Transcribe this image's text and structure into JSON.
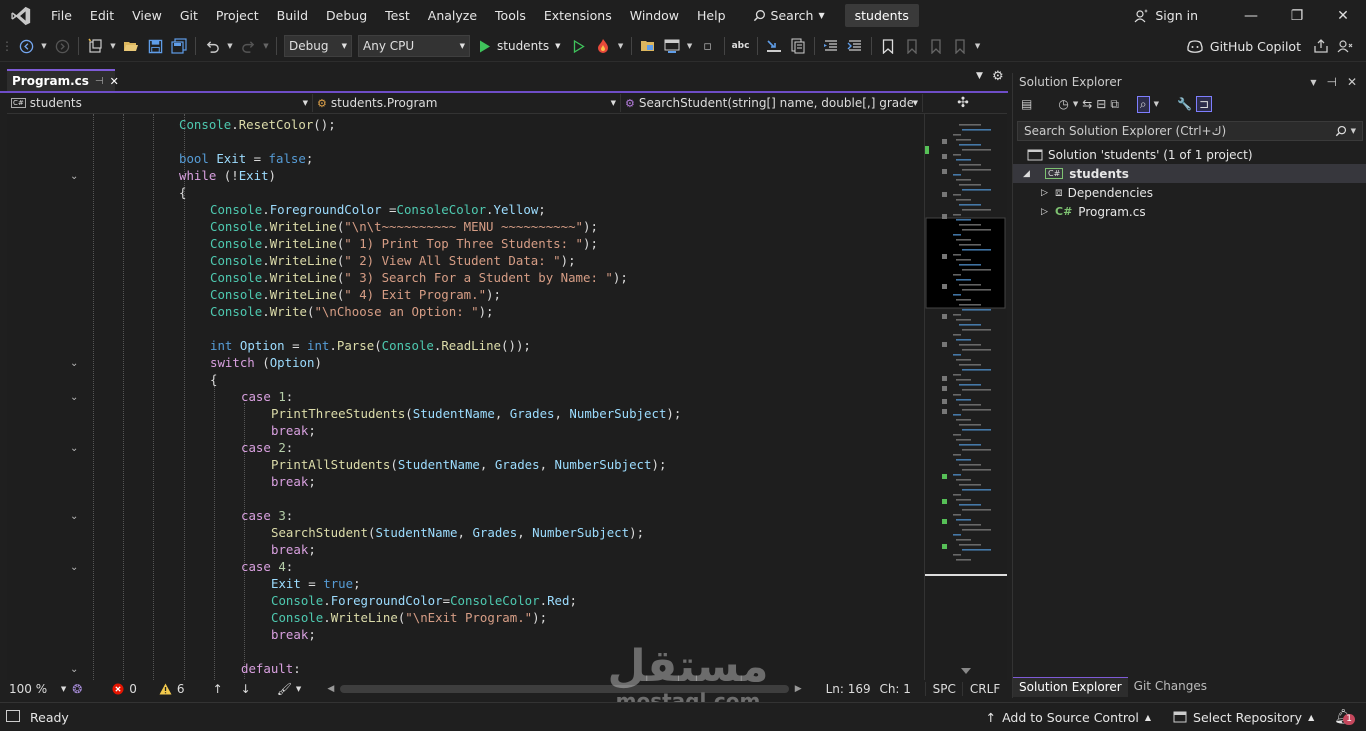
{
  "menubar": {
    "items": [
      "File",
      "Edit",
      "View",
      "Git",
      "Project",
      "Build",
      "Debug",
      "Test",
      "Analyze",
      "Tools",
      "Extensions",
      "Window",
      "Help"
    ],
    "search_label": "Search",
    "solution_name": "students",
    "sign_in": "Sign in"
  },
  "toolbar": {
    "config": "Debug",
    "platform": "Any CPU",
    "run_target": "students",
    "copilot": "GitHub Copilot"
  },
  "tabs": [
    {
      "label": "Program.cs",
      "pin": "⊣",
      "close": "✕"
    }
  ],
  "navbar": {
    "project": "students",
    "class": "students.Program",
    "member": "SearchStudent(string[] name, double[,] grades, int i"
  },
  "editor": {
    "lines": [
      [
        [
          "Console",
          "ty"
        ],
        [
          ".",
          "pl"
        ],
        [
          "ResetColor",
          "fn"
        ],
        [
          "();",
          "pl"
        ]
      ],
      [],
      [
        [
          "bool",
          "kw"
        ],
        [
          " ",
          "pl"
        ],
        [
          "Exit",
          "va"
        ],
        [
          " = ",
          "pl"
        ],
        [
          "false",
          "kw"
        ],
        [
          ";",
          "pl"
        ]
      ],
      [
        [
          "while",
          "ctl"
        ],
        [
          " (!",
          "pl"
        ],
        [
          "Exit",
          "va"
        ],
        [
          ")",
          "pl"
        ]
      ],
      [
        [
          "{",
          "pl"
        ]
      ],
      [
        [
          "Console",
          "ty"
        ],
        [
          ".",
          "pl"
        ],
        [
          "ForegroundColor",
          "va"
        ],
        [
          " =",
          "pl"
        ],
        [
          "ConsoleColor",
          "ty"
        ],
        [
          ".",
          "pl"
        ],
        [
          "Yellow",
          "va"
        ],
        [
          ";",
          "pl"
        ]
      ],
      [
        [
          "Console",
          "ty"
        ],
        [
          ".",
          "pl"
        ],
        [
          "WriteLine",
          "fn"
        ],
        [
          "(",
          "pl"
        ],
        [
          "\"\\n\\t~~~~~~~~~~ MENU ~~~~~~~~~~\"",
          "st"
        ],
        [
          ");",
          "pl"
        ]
      ],
      [
        [
          "Console",
          "ty"
        ],
        [
          ".",
          "pl"
        ],
        [
          "WriteLine",
          "fn"
        ],
        [
          "(",
          "pl"
        ],
        [
          "\" 1) Print Top Three Students: \"",
          "st"
        ],
        [
          ");",
          "pl"
        ]
      ],
      [
        [
          "Console",
          "ty"
        ],
        [
          ".",
          "pl"
        ],
        [
          "WriteLine",
          "fn"
        ],
        [
          "(",
          "pl"
        ],
        [
          "\" 2) View All Student Data: \"",
          "st"
        ],
        [
          ");",
          "pl"
        ]
      ],
      [
        [
          "Console",
          "ty"
        ],
        [
          ".",
          "pl"
        ],
        [
          "WriteLine",
          "fn"
        ],
        [
          "(",
          "pl"
        ],
        [
          "\" 3) Search For a Student by Name: \"",
          "st"
        ],
        [
          ");",
          "pl"
        ]
      ],
      [
        [
          "Console",
          "ty"
        ],
        [
          ".",
          "pl"
        ],
        [
          "WriteLine",
          "fn"
        ],
        [
          "(",
          "pl"
        ],
        [
          "\" 4) Exit Program.\"",
          "st"
        ],
        [
          ");",
          "pl"
        ]
      ],
      [
        [
          "Console",
          "ty"
        ],
        [
          ".",
          "pl"
        ],
        [
          "Write",
          "fn"
        ],
        [
          "(",
          "pl"
        ],
        [
          "\"\\nChoose an Option: \"",
          "st"
        ],
        [
          ");",
          "pl"
        ]
      ],
      [],
      [
        [
          "int",
          "kw"
        ],
        [
          " ",
          "pl"
        ],
        [
          "Option",
          "va"
        ],
        [
          " = ",
          "pl"
        ],
        [
          "int",
          "kw"
        ],
        [
          ".",
          "pl"
        ],
        [
          "Parse",
          "fn"
        ],
        [
          "(",
          "pl"
        ],
        [
          "Console",
          "ty"
        ],
        [
          ".",
          "pl"
        ],
        [
          "ReadLine",
          "fn"
        ],
        [
          "());",
          "pl"
        ]
      ],
      [
        [
          "switch",
          "ctl"
        ],
        [
          " (",
          "pl"
        ],
        [
          "Option",
          "va"
        ],
        [
          ")",
          "pl"
        ]
      ],
      [
        [
          "{",
          "pl"
        ]
      ],
      [
        [
          "case",
          "ctl"
        ],
        [
          " ",
          "pl"
        ],
        [
          "1",
          "nm"
        ],
        [
          ":",
          "pl"
        ]
      ],
      [
        [
          "PrintThreeStudents",
          "fn"
        ],
        [
          "(",
          "pl"
        ],
        [
          "StudentName",
          "va"
        ],
        [
          ", ",
          "pl"
        ],
        [
          "Grades",
          "va"
        ],
        [
          ", ",
          "pl"
        ],
        [
          "NumberSubject",
          "va"
        ],
        [
          ");",
          "pl"
        ]
      ],
      [
        [
          "break",
          "ctl"
        ],
        [
          ";",
          "pl"
        ]
      ],
      [
        [
          "case",
          "ctl"
        ],
        [
          " ",
          "pl"
        ],
        [
          "2",
          "nm"
        ],
        [
          ":",
          "pl"
        ]
      ],
      [
        [
          "PrintAllStudents",
          "fn"
        ],
        [
          "(",
          "pl"
        ],
        [
          "StudentName",
          "va"
        ],
        [
          ", ",
          "pl"
        ],
        [
          "Grades",
          "va"
        ],
        [
          ", ",
          "pl"
        ],
        [
          "NumberSubject",
          "va"
        ],
        [
          ");",
          "pl"
        ]
      ],
      [
        [
          "break",
          "ctl"
        ],
        [
          ";",
          "pl"
        ]
      ],
      [],
      [
        [
          "case",
          "ctl"
        ],
        [
          " ",
          "pl"
        ],
        [
          "3",
          "nm"
        ],
        [
          ":",
          "pl"
        ]
      ],
      [
        [
          "SearchStudent",
          "fn"
        ],
        [
          "(",
          "pl"
        ],
        [
          "StudentName",
          "va"
        ],
        [
          ", ",
          "pl"
        ],
        [
          "Grades",
          "va"
        ],
        [
          ", ",
          "pl"
        ],
        [
          "NumberSubject",
          "va"
        ],
        [
          ");",
          "pl"
        ]
      ],
      [
        [
          "break",
          "ctl"
        ],
        [
          ";",
          "pl"
        ]
      ],
      [
        [
          "case",
          "ctl"
        ],
        [
          " ",
          "pl"
        ],
        [
          "4",
          "nm"
        ],
        [
          ":",
          "pl"
        ]
      ],
      [
        [
          "Exit",
          "va"
        ],
        [
          " = ",
          "pl"
        ],
        [
          "true",
          "kw"
        ],
        [
          ";",
          "pl"
        ]
      ],
      [
        [
          "Console",
          "ty"
        ],
        [
          ".",
          "pl"
        ],
        [
          "ForegroundColor",
          "va"
        ],
        [
          "=",
          "pl"
        ],
        [
          "ConsoleColor",
          "ty"
        ],
        [
          ".",
          "pl"
        ],
        [
          "Red",
          "va"
        ],
        [
          ";",
          "pl"
        ]
      ],
      [
        [
          "Console",
          "ty"
        ],
        [
          ".",
          "pl"
        ],
        [
          "WriteLine",
          "fn"
        ],
        [
          "(",
          "pl"
        ],
        [
          "\"\\nExit Program.\"",
          "st"
        ],
        [
          ");",
          "pl"
        ]
      ],
      [
        [
          "break",
          "ctl"
        ],
        [
          ";",
          "pl"
        ]
      ],
      [],
      [
        [
          "default",
          "ctl"
        ],
        [
          ":",
          "pl"
        ]
      ]
    ]
  },
  "editor_status": {
    "zoom": "100 %",
    "errors": "0",
    "warnings": "6",
    "line": "Ln: 169",
    "col": "Ch: 1",
    "whitespace": "SPC",
    "line_ending": "CRLF"
  },
  "solution_explorer": {
    "title": "Solution Explorer",
    "search_placeholder": "Search Solution Explorer (Ctrl+ك)",
    "tree": {
      "solution": "Solution 'students' (1 of 1 project)",
      "project": "students",
      "dependencies": "Dependencies",
      "file": "Program.cs"
    },
    "tab_solution": "Solution Explorer",
    "tab_git": "Git Changes"
  },
  "statusbar": {
    "ready": "Ready",
    "source_control": "Add to Source Control",
    "repository": "Select Repository",
    "notifications": "1"
  },
  "watermark": {
    "arabic": "مستقل",
    "latin": "mostaql.com"
  },
  "colors": {
    "accent": "#7e5bd6",
    "keyword": "#569cd6",
    "type": "#4ec9b0",
    "string": "#d69d85",
    "method": "#dcdcaa"
  }
}
